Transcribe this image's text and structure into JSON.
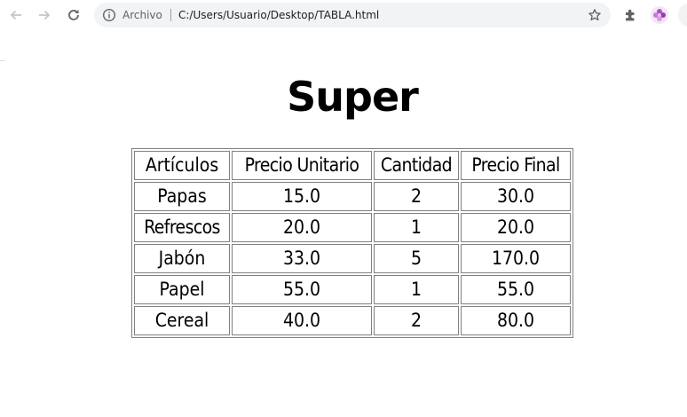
{
  "browser": {
    "scheme_label": "Archivo",
    "url": "C:/Users/Usuario/Desktop/TABLA.html"
  },
  "page": {
    "title": "Super",
    "table": {
      "headers": [
        "Artículos",
        "Precio Unitario",
        "Cantidad",
        "Precio Final"
      ],
      "rows": [
        [
          "Papas",
          "15.0",
          "2",
          "30.0"
        ],
        [
          "Refrescos",
          "20.0",
          "1",
          "20.0"
        ],
        [
          "Jabón",
          "33.0",
          "5",
          "170.0"
        ],
        [
          "Papel",
          "55.0",
          "1",
          "55.0"
        ],
        [
          "Cereal",
          "40.0",
          "2",
          "80.0"
        ]
      ]
    }
  }
}
